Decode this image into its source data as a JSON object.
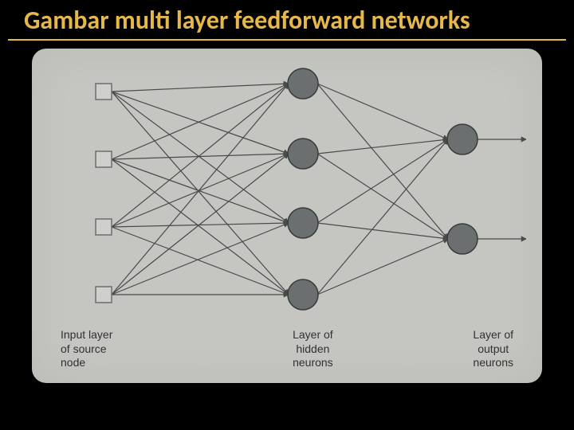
{
  "title": "Gambar multi layer feedforward networks",
  "captions": {
    "input": "Input layer\nof source\nnode",
    "hidden": "Layer of\nhidden\nneurons",
    "output": "Layer of\noutput\nneurons"
  },
  "network": {
    "input_count": 4,
    "hidden_count": 4,
    "output_count": 2,
    "x": {
      "input": 70,
      "hidden": 320,
      "output": 520,
      "exit": 600
    },
    "y_input": [
      40,
      125,
      210,
      295
    ],
    "y_hidden": [
      30,
      118,
      205,
      295
    ],
    "y_output": [
      100,
      225
    ]
  },
  "style": {
    "node_fill": "#6b6f6f",
    "node_stroke": "#3a3c3c",
    "square_stroke": "#6d6d6d",
    "line_stroke": "#4a4a4a"
  }
}
